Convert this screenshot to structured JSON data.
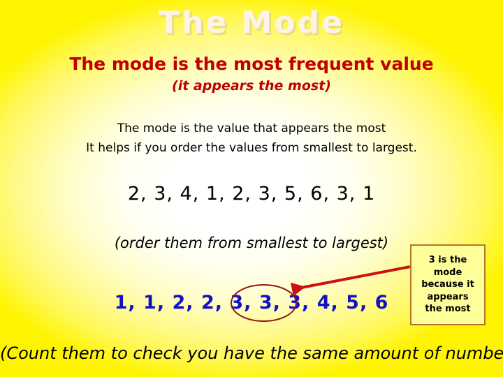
{
  "slide": {
    "title": "The Mode",
    "background_color_edge": "#FFF400",
    "background_color_center": "#FFFFFF"
  },
  "heading": {
    "line1": "The mode is the most frequent value",
    "line2": "(it appears the most)",
    "color": "#C00000"
  },
  "explanation": {
    "line1": "The mode is the value that appears the most",
    "line2": "It helps if you order the values from smallest to largest.",
    "color": "#000000"
  },
  "numbers": {
    "unordered_label": "2, 3, 4, 1, 2, 3, 5, 6, 3, 1",
    "unordered_values": [
      2,
      3,
      4,
      1,
      2,
      3,
      5,
      6,
      3,
      1
    ],
    "unordered_color": "#000000",
    "order_instruction": "(order them from smallest to largest)",
    "ordered_label": "1, 1, 2, 2, 3, 3, 3, 4, 5, 6",
    "ordered_values": [
      1,
      1,
      2,
      2,
      3,
      3,
      3,
      4,
      5,
      6
    ],
    "ordered_color": "#1212C4",
    "mode_value": "3",
    "highlight_color": "#8B1A14"
  },
  "callout": {
    "line1": "3 is the",
    "line2": "mode",
    "line3": "because it",
    "line4": "appears",
    "line5": "the most",
    "border_color": "#B5762B",
    "fill_color": "#FFFF99"
  },
  "arrow": {
    "color": "#CC1111"
  },
  "footer": {
    "note": "(Count them to check you have the same amount of numbers)"
  }
}
